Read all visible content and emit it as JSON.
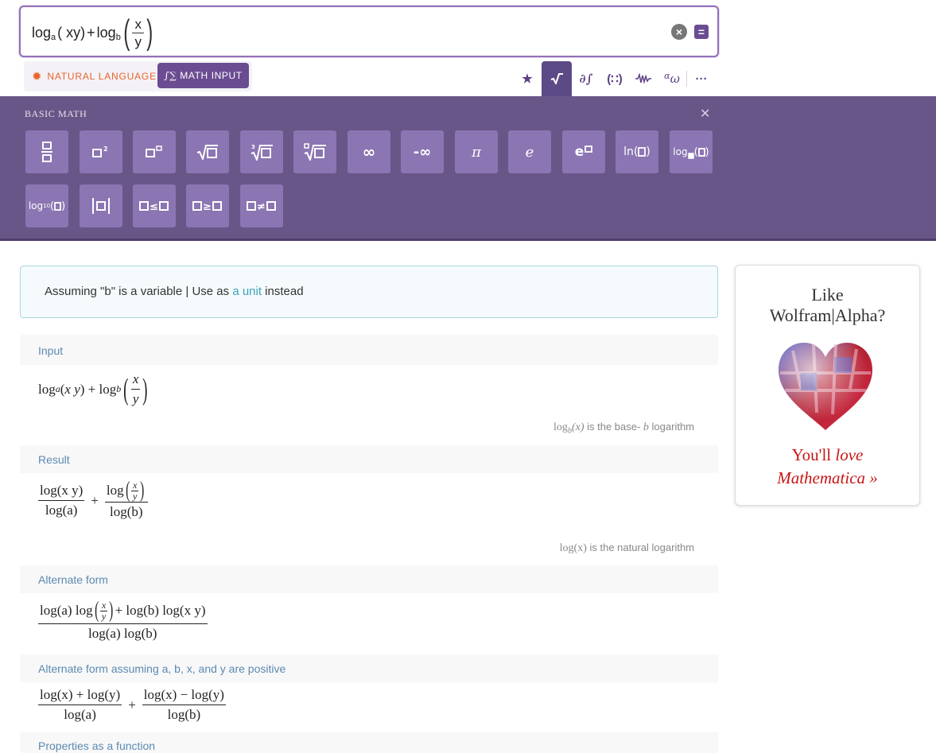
{
  "input": {
    "log_a_prefix": "log",
    "log_a_sub": "a",
    "log_a_arg": "( xy)",
    "plus": "+",
    "log_b_prefix": "log",
    "log_b_sub": "b",
    "frac_num": "x",
    "frac_den": "y",
    "clear_icon": "x-circle-icon",
    "go_icon": "equals-icon"
  },
  "modes": {
    "natural_language": "NATURAL LANGUAGE",
    "math_input": "MATH INPUT"
  },
  "palette_tabs": [
    {
      "icon": "star-icon",
      "glyph": "★"
    },
    {
      "icon": "sqrt-icon",
      "glyph": "√‾",
      "active": true
    },
    {
      "icon": "calculus-icon",
      "glyph": "∂∫"
    },
    {
      "icon": "matrix-icon",
      "glyph": "(∷)"
    },
    {
      "icon": "waveform-icon",
      "glyph": "∿∿"
    },
    {
      "icon": "greek-icon",
      "glyph": "αω"
    },
    {
      "icon": "more-icon",
      "glyph": "···"
    }
  ],
  "palette": {
    "title": "BASIC MATH",
    "close_icon": "close-icon",
    "row1": [
      "□/□",
      "□²",
      "□^□",
      "√□",
      "∛□",
      "ⁿ√□",
      "∞",
      "-∞",
      "π",
      "e",
      "e^□",
      "ln(□)",
      "log_□(□)"
    ],
    "row2": [
      "log₁₀(□)",
      "|□|",
      "□≤□",
      "□≥□",
      "□≠□"
    ],
    "labels": {
      "infinity": "∞",
      "neg_infinity": "-∞",
      "pi": "π",
      "e": "e",
      "ln": "ln(",
      "ln_close": ")",
      "log": "log",
      "log10": "log",
      "log10_sub": "10"
    }
  },
  "assumption": {
    "prefix": "Assuming \"b\" is a variable | Use as ",
    "link": "a unit",
    "suffix": " instead"
  },
  "pods": {
    "input": {
      "title": "Input",
      "note_expr": "log",
      "note_sub": "b",
      "note_arg": "(x)",
      "note_text": " is the base- ",
      "note_b": "b",
      "note_tail": " logarithm"
    },
    "result": {
      "title": "Result",
      "num1": "log(x y)",
      "den1": "log(a)",
      "num2_pre": "log",
      "den2": "log(b)",
      "note_expr": "log(x)",
      "note_text": " is the natural logarithm"
    },
    "alternate": {
      "title": "Alternate form",
      "num_a": "log(a) log",
      "num_b": "+ log(b) log(x y)",
      "den": "log(a) log(b)"
    },
    "alternate_positive": {
      "title": "Alternate form assuming a, b, x, and y are positive",
      "num1": "log(x) + log(y)",
      "den1": "log(a)",
      "num2": "log(x) − log(y)",
      "den2": "log(b)"
    },
    "properties": {
      "title": "Properties as a function"
    }
  },
  "ad": {
    "line1": "Like",
    "line2": "Wolfram|Alpha?",
    "cta1": "You'll ",
    "cta1_it": "love",
    "cta2": "Mathematica »"
  }
}
